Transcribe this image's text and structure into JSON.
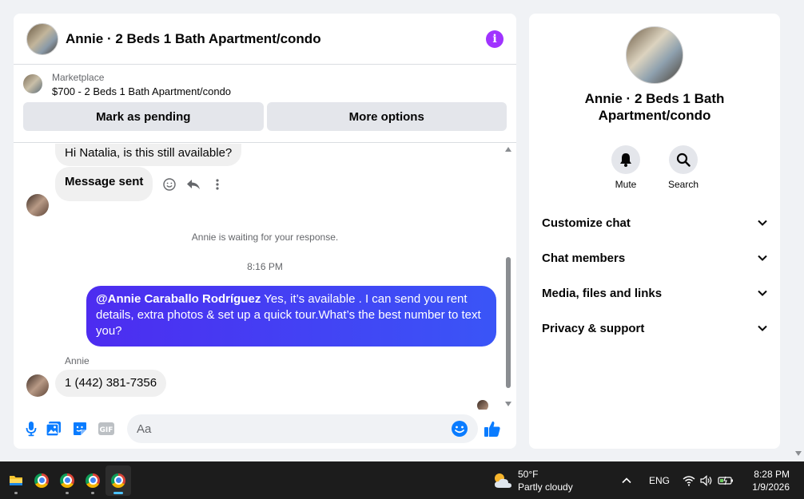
{
  "chat": {
    "title": "Annie · 2 Beds 1 Bath Apartment/condo",
    "listing": {
      "source": "Marketplace",
      "price_title": "$700 - 2 Beds 1 Bath Apartment/condo",
      "mark_pending_label": "Mark as pending",
      "more_options_label": "More options"
    },
    "messages": {
      "m1": "Hi Natalia, is this still available?",
      "m2": "Message sent",
      "waiting_note": "Annie is waiting for your response.",
      "timestamp": "8:16 PM",
      "out_mention": "@Annie Caraballo Rodríguez",
      "out_text": " Yes, it’s available .  I can send you rent details, extra photos & set up a quick tour.What’s the best number to text you?",
      "sender_name": "Annie",
      "m3": "1 (442) 381-7356"
    },
    "composer": {
      "placeholder": "Aa"
    },
    "accent": "#0a7cff"
  },
  "info": {
    "name": "Annie · 2 Beds 1 Bath Apartment/condo",
    "actions": [
      {
        "label": "Mute",
        "icon": "bell-icon"
      },
      {
        "label": "Search",
        "icon": "search-icon"
      }
    ],
    "sections": [
      {
        "label": "Customize chat"
      },
      {
        "label": "Chat members"
      },
      {
        "label": "Media, files and links"
      },
      {
        "label": "Privacy & support"
      }
    ]
  },
  "taskbar": {
    "weather_temp": "50°F",
    "weather_desc": "Partly cloudy",
    "lang": "ENG",
    "time": "8:28 PM",
    "date": "1/9/2026"
  }
}
